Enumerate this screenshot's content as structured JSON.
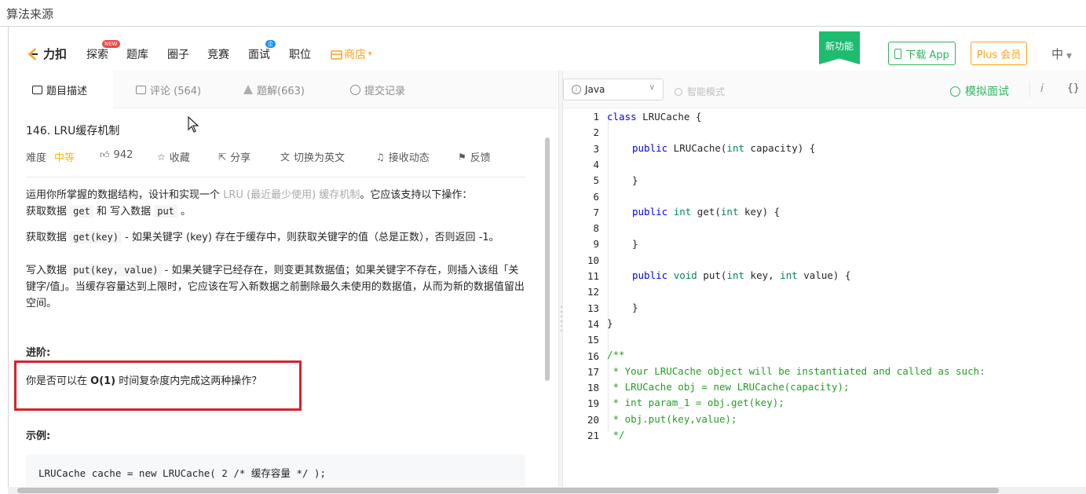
{
  "window_title": "算法来源",
  "nav": {
    "logo_text": "力扣",
    "items": [
      "探索",
      "题库",
      "圈子",
      "竞赛",
      "面试",
      "职位"
    ],
    "explore_badge": "NEW",
    "interview_badge": "企业",
    "shop": "商店",
    "new_feature": "新功能",
    "download_app": "下载 App",
    "plus": "Plus 会员",
    "lang": "中"
  },
  "tabs": {
    "description": "题目描述",
    "comments": "评论 (564)",
    "solutions": "题解(663)",
    "submissions": "提交记录"
  },
  "problem": {
    "title": "146. LRU缓存机制",
    "difficulty_label": "难度",
    "difficulty": "中等",
    "likes": "942",
    "favorite": "收藏",
    "share": "分享",
    "switch_lang": "切换为英文",
    "follow": "接收动态",
    "feedback": "反馈",
    "p1_a": "运用你所掌握的数据结构，设计和实现一个 ",
    "p1_link": "LRU (最近最少使用) 缓存机制",
    "p1_b": "。它应该支持以下操作：",
    "p1_c": "获取数据 ",
    "p1_get": "get",
    "p1_d": " 和 写入数据 ",
    "p1_put": "put",
    "p1_e": " 。",
    "p2_a": "获取数据 ",
    "p2_code": "get(key)",
    "p2_b": " - 如果关键字 (key) 存在于缓存中，则获取关键字的值（总是正数），否则返回 -1。",
    "p3_a": "写入数据 ",
    "p3_code": "put(key, value)",
    "p3_b": " - 如果关键字已经存在，则变更其数据值；如果关键字不存在，则插入该组「关键字/值」。当缓存容量达到上限时，它应该在写入新数据之前删除最久未使用的数据值，从而为新的数据值留出空间。",
    "advanced_heading": "进阶:",
    "advanced_q_a": "你是否可以在 ",
    "advanced_q_b": "O(1)",
    "advanced_q_c": " 时间复杂度内完成这两种操作？",
    "example_heading": "示例:",
    "example_code": "LRUCache cache = new LRUCache( 2 /* 缓存容量 */ );"
  },
  "editor": {
    "language": "Java",
    "smart_mode": "智能模式",
    "mock_interview": "模拟面试",
    "info_label": "i",
    "braces_label": "{}",
    "line_numbers": [
      "1",
      "2",
      "3",
      "4",
      "5",
      "6",
      "7",
      "8",
      "9",
      "10",
      "11",
      "12",
      "13",
      "14",
      "15",
      "16",
      "17",
      "18",
      "19",
      "20",
      "21"
    ],
    "code": {
      "l1_kw": "class",
      "l1_rest": " LRUCache {",
      "l3_kw": "public",
      "l3_a": " LRUCache(",
      "l3_ty": "int",
      "l3_b": " capacity) {",
      "l5": "}",
      "l7_kw": "public",
      "l7_ty": "int",
      "l7_a": " get(",
      "l7_ty2": "int",
      "l7_b": " key) {",
      "l9": "}",
      "l11_kw": "public",
      "l11_ty": "void",
      "l11_a": " put(",
      "l11_ty2": "int",
      "l11_b": " key, ",
      "l11_ty3": "int",
      "l11_c": " value) {",
      "l13": "}",
      "l14": "}",
      "l16": "/**",
      "l17": " * Your LRUCache object will be instantiated and called as such:",
      "l18": " * LRUCache obj = new LRUCache(capacity);",
      "l19": " * int param_1 = obj.get(key);",
      "l20": " * obj.put(key,value);",
      "l21": " */"
    }
  },
  "colors": {
    "brand_orange": "#ffa116",
    "green": "#2db55d",
    "highlight_red": "#d5232a",
    "keyword_blue": "#0000ff",
    "comment_green": "#22a022"
  }
}
